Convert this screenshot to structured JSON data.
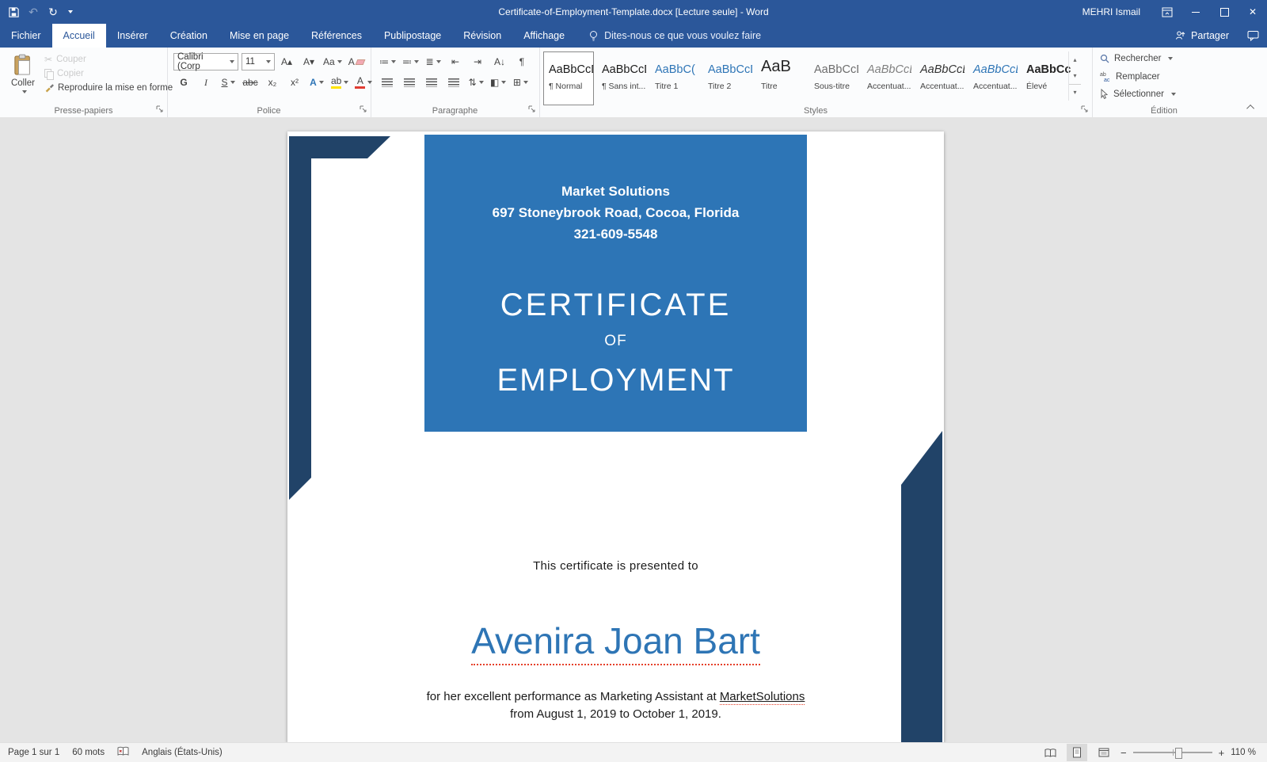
{
  "titlebar": {
    "title": "Certificate-of-Employment-Template.docx [Lecture seule]  -  Word",
    "user": "MEHRI Ismail"
  },
  "tabs": {
    "file": "Fichier",
    "home": "Accueil",
    "insert": "Insérer",
    "design": "Création",
    "layout": "Mise en page",
    "references": "Références",
    "mailings": "Publipostage",
    "review": "Révision",
    "view": "Affichage",
    "tellme": "Dites-nous ce que vous voulez faire",
    "share": "Partager"
  },
  "ribbon": {
    "clipboard": {
      "label": "Presse-papiers",
      "paste": "Coller",
      "cut": "Couper",
      "copy": "Copier",
      "format_painter": "Reproduire la mise en forme"
    },
    "font": {
      "label": "Police",
      "name": "Calibri (Corp",
      "size": "11",
      "bold": "G",
      "italic": "I",
      "underline": "S"
    },
    "paragraph": {
      "label": "Paragraphe"
    },
    "styles": {
      "label": "Styles",
      "items": [
        {
          "preview": "AaBbCcDc",
          "label": "¶ Normal"
        },
        {
          "preview": "AaBbCcDc",
          "label": "¶ Sans int..."
        },
        {
          "preview": "AaBbC(",
          "label": "Titre 1"
        },
        {
          "preview": "AaBbCcD",
          "label": "Titre 2"
        },
        {
          "preview": "AaB",
          "label": "Titre"
        },
        {
          "preview": "AaBbCcD",
          "label": "Sous-titre"
        },
        {
          "preview": "AaBbCcDt",
          "label": "Accentuat..."
        },
        {
          "preview": "AaBbCcDt",
          "label": "Accentuat..."
        },
        {
          "preview": "AaBbCcDt",
          "label": "Accentuat..."
        },
        {
          "preview": "AaBbCcDc",
          "label": "Élevé"
        }
      ]
    },
    "editing": {
      "label": "Édition",
      "find": "Rechercher",
      "replace": "Remplacer",
      "select": "Sélectionner"
    }
  },
  "document": {
    "company": "Market Solutions",
    "address": "697 Stoneybrook Road, Cocoa, Florida",
    "phone": "321-609-5548",
    "cert_line1": "CERTIFICATE",
    "cert_line2": "OF",
    "cert_line3": "EMPLOYMENT",
    "presented": "This certificate is presented to",
    "recipient": "Avenira Joan Bart",
    "body_pre": "for her excellent performance as Marketing Assistant at ",
    "body_link": "MarketSolutions",
    "body_line2": "from August 1, 2019 to October 1, 2019."
  },
  "statusbar": {
    "page": "Page 1 sur 1",
    "words": "60 mots",
    "language": "Anglais (États-Unis)",
    "zoom": "110 %"
  },
  "colors": {
    "titlebar_blue": "#2b579a",
    "certificate_blue": "#2d75b6",
    "accent_navy": "#214368",
    "recipient_blue": "#2e75b5"
  },
  "icons": {
    "undo": "↶",
    "redo": "↻",
    "close": "✕",
    "scissors": "✂",
    "grow_font": "A▴",
    "shrink_font": "A▾",
    "change_case": "Aa",
    "strike": "abc",
    "subscript": "x₂",
    "superscript": "x²",
    "text_effects": "A",
    "font_color": "A",
    "highlight_pen": "ab",
    "eraser_a": "A",
    "bullets": "≔",
    "numbering": "≕",
    "multilevel": "≣",
    "outdent": "⇤",
    "indent": "⇥",
    "sort": "A↓",
    "pilcrow": "¶",
    "line_spacing": "⇅",
    "shading": "◧",
    "borders": "⊞",
    "select": "▷",
    "up": "▴",
    "down": "▾",
    "minus": "−",
    "plus": "+"
  }
}
